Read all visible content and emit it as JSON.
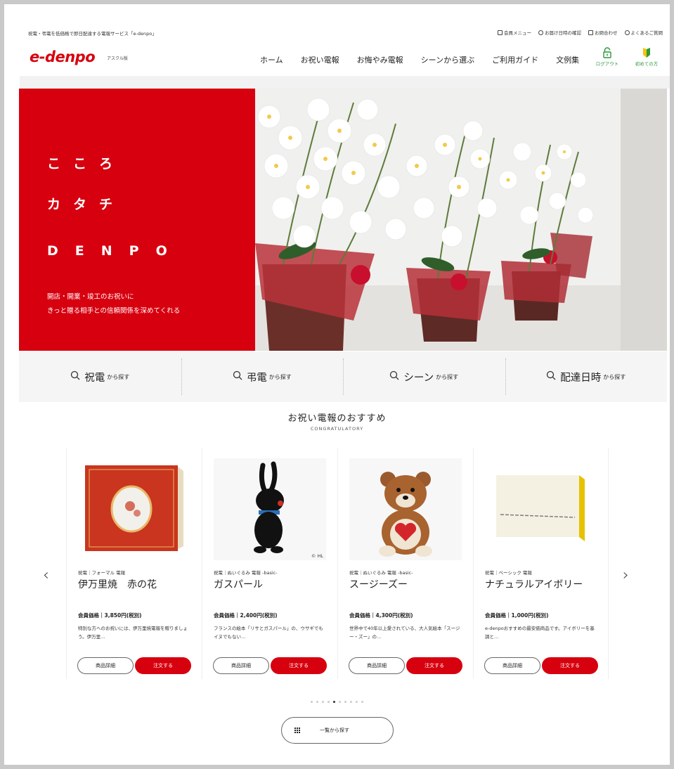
{
  "utility": {
    "tagline": "祝電・弔電を低価格で即日配達する電報サービス「e-denpo」",
    "links": [
      {
        "label": "会員メニュー",
        "icon": "book-icon"
      },
      {
        "label": "お届け日時の確認",
        "icon": "shield-icon"
      },
      {
        "label": "お問合わせ",
        "icon": "mail-icon"
      },
      {
        "label": "よくあるご質問",
        "icon": "question-icon"
      }
    ]
  },
  "header": {
    "logo": "e-denpo",
    "logo_sub": "アスクル版",
    "nav": [
      "ホーム",
      "お祝い電報",
      "お悔やみ電報",
      "シーンから選ぶ",
      "ご利用ガイド",
      "文例集"
    ],
    "logout_label": "ログアウト",
    "beginner_label": "初めての方"
  },
  "hero": {
    "line1": "こころ",
    "line2": "カタチ",
    "line3": "DENPO",
    "desc1": "開店・開業・竣工のお祝いに",
    "desc2": "きっと贈る相手との信頼関係を深めてくれる"
  },
  "search": [
    {
      "main": "祝電",
      "suffix": "から探す"
    },
    {
      "main": "弔電",
      "suffix": "から探す"
    },
    {
      "main": "シーン",
      "suffix": "から探す"
    },
    {
      "main": "配達日時",
      "suffix": "から探す"
    }
  ],
  "section": {
    "title": "お祝い電報のおすすめ",
    "subtitle": "CONGRATULATORY"
  },
  "carousel": {
    "prev": "‹",
    "next": "›",
    "detail_label": "商品詳細",
    "order_label": "注文する",
    "items": [
      {
        "category": "祝電｜フォーマル 電報",
        "name": "伊万里焼　赤の花",
        "price": "会員価格｜3,850円(税別)",
        "desc": "特別な方へのお祝いには、伊万里焼電報を贈りましょう。伊万里…"
      },
      {
        "category": "祝電｜ぬいぐるみ 電報 -basic-",
        "name": "ガスパール",
        "price": "会員価格｜2,400円(税別)",
        "desc": "フランスの絵本「リサとガスパール」の、ウサギでもイヌでもない…",
        "copyright": "© HL"
      },
      {
        "category": "祝電｜ぬいぐるみ 電報 -basic-",
        "name": "スージーズー",
        "price": "会員価格｜4,300円(税別)",
        "desc": "世界中で40年以上愛されている、大人気絵本「スージー・ズー」の…"
      },
      {
        "category": "祝電｜ベーシック 電報",
        "name": "ナチュラルアイボリー",
        "price": "会員価格｜1,000円(税別)",
        "desc": "e-denpoおすすめの最安価商品です。アイボリーを基調と…"
      }
    ],
    "dots": 10,
    "active_dot": 4
  },
  "list_button": "一覧から探す"
}
